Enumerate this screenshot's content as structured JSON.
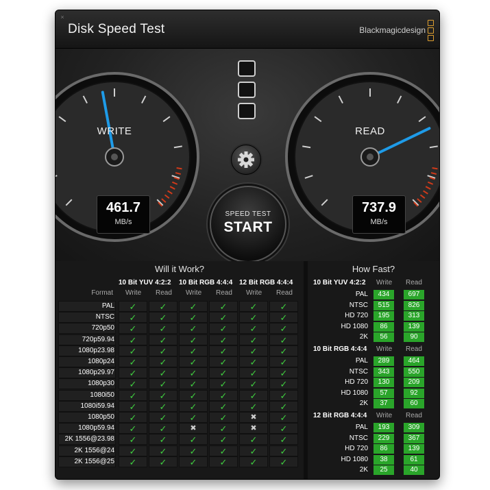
{
  "window": {
    "title": "Disk Speed Test",
    "brand": "Blackmagicdesign",
    "close_glyph": "×"
  },
  "write_gauge": {
    "label": "WRITE",
    "value": "461.7",
    "unit": "MB/s"
  },
  "read_gauge": {
    "label": "READ",
    "value": "737.9",
    "unit": "MB/s"
  },
  "start_button": {
    "line1": "SPEED TEST",
    "line2": "START"
  },
  "settings_icon": "gear-icon",
  "colors": {
    "accent_needle": "#1e9be8",
    "ok_green": "#3fcf3f",
    "fast_green": "#2aa52a",
    "redline": "#d03a1a"
  },
  "will_it_work": {
    "heading": "Will it Work?",
    "format_header": "Format",
    "groups": [
      {
        "name": "10 Bit YUV 4:2:2",
        "write": "Write",
        "read": "Read"
      },
      {
        "name": "10 Bit RGB 4:4:4",
        "write": "Write",
        "read": "Read"
      },
      {
        "name": "12 Bit RGB 4:4:4",
        "write": "Write",
        "read": "Read"
      }
    ],
    "rows": [
      {
        "format": "PAL",
        "cells": [
          "✓",
          "✓",
          "✓",
          "✓",
          "✓",
          "✓"
        ]
      },
      {
        "format": "NTSC",
        "cells": [
          "✓",
          "✓",
          "✓",
          "✓",
          "✓",
          "✓"
        ]
      },
      {
        "format": "720p50",
        "cells": [
          "✓",
          "✓",
          "✓",
          "✓",
          "✓",
          "✓"
        ]
      },
      {
        "format": "720p59.94",
        "cells": [
          "✓",
          "✓",
          "✓",
          "✓",
          "✓",
          "✓"
        ]
      },
      {
        "format": "1080p23.98",
        "cells": [
          "✓",
          "✓",
          "✓",
          "✓",
          "✓",
          "✓"
        ]
      },
      {
        "format": "1080p24",
        "cells": [
          "✓",
          "✓",
          "✓",
          "✓",
          "✓",
          "✓"
        ]
      },
      {
        "format": "1080p29.97",
        "cells": [
          "✓",
          "✓",
          "✓",
          "✓",
          "✓",
          "✓"
        ]
      },
      {
        "format": "1080p30",
        "cells": [
          "✓",
          "✓",
          "✓",
          "✓",
          "✓",
          "✓"
        ]
      },
      {
        "format": "1080i50",
        "cells": [
          "✓",
          "✓",
          "✓",
          "✓",
          "✓",
          "✓"
        ]
      },
      {
        "format": "1080i59.94",
        "cells": [
          "✓",
          "✓",
          "✓",
          "✓",
          "✓",
          "✓"
        ]
      },
      {
        "format": "1080p50",
        "cells": [
          "✓",
          "✓",
          "✓",
          "✓",
          "✖",
          "✓"
        ]
      },
      {
        "format": "1080p59.94",
        "cells": [
          "✓",
          "✓",
          "✖",
          "✓",
          "✖",
          "✓"
        ]
      },
      {
        "format": "2K 1556@23.98",
        "cells": [
          "✓",
          "✓",
          "✓",
          "✓",
          "✓",
          "✓"
        ]
      },
      {
        "format": "2K 1556@24",
        "cells": [
          "✓",
          "✓",
          "✓",
          "✓",
          "✓",
          "✓"
        ]
      },
      {
        "format": "2K 1556@25",
        "cells": [
          "✓",
          "✓",
          "✓",
          "✓",
          "✓",
          "✓"
        ]
      }
    ]
  },
  "how_fast": {
    "heading": "How Fast?",
    "groups": [
      {
        "name": "10 Bit YUV 4:2:2",
        "write": "Write",
        "read": "Read",
        "rows": [
          {
            "format": "PAL",
            "write": "434",
            "read": "697"
          },
          {
            "format": "NTSC",
            "write": "515",
            "read": "826"
          },
          {
            "format": "HD 720",
            "write": "195",
            "read": "313"
          },
          {
            "format": "HD 1080",
            "write": "86",
            "read": "139"
          },
          {
            "format": "2K",
            "write": "56",
            "read": "90"
          }
        ]
      },
      {
        "name": "10 Bit RGB 4:4:4",
        "write": "Write",
        "read": "Read",
        "rows": [
          {
            "format": "PAL",
            "write": "289",
            "read": "464"
          },
          {
            "format": "NTSC",
            "write": "343",
            "read": "550"
          },
          {
            "format": "HD 720",
            "write": "130",
            "read": "209"
          },
          {
            "format": "HD 1080",
            "write": "57",
            "read": "92"
          },
          {
            "format": "2K",
            "write": "37",
            "read": "60"
          }
        ]
      },
      {
        "name": "12 Bit RGB 4:4:4",
        "write": "Write",
        "read": "Read",
        "rows": [
          {
            "format": "PAL",
            "write": "193",
            "read": "309"
          },
          {
            "format": "NTSC",
            "write": "229",
            "read": "367"
          },
          {
            "format": "HD 720",
            "write": "86",
            "read": "139"
          },
          {
            "format": "HD 1080",
            "write": "38",
            "read": "61"
          },
          {
            "format": "2K",
            "write": "25",
            "read": "40"
          }
        ]
      }
    ]
  }
}
